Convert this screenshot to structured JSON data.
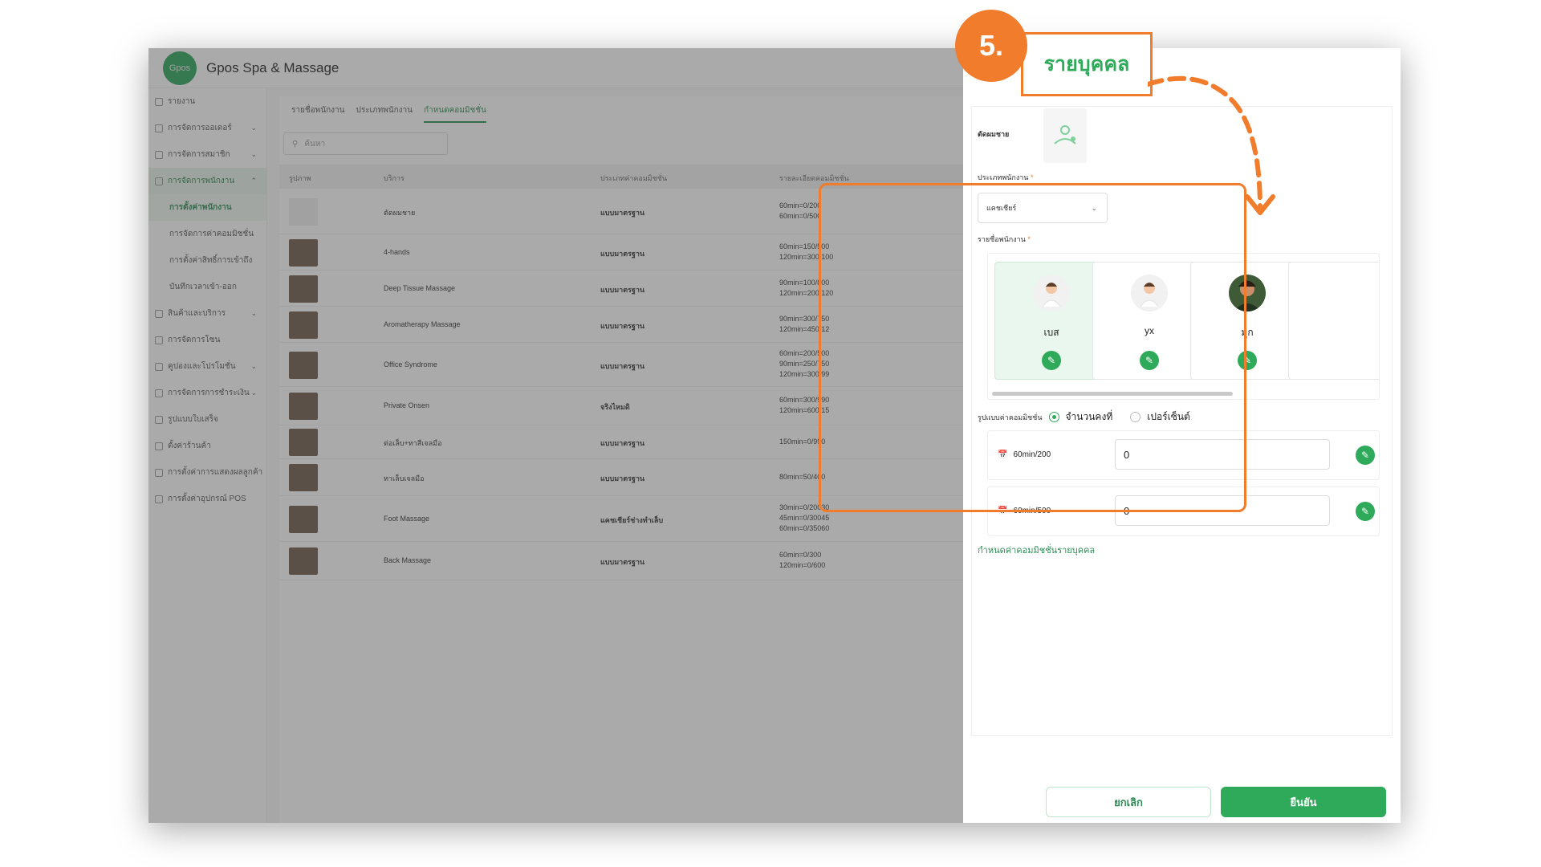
{
  "app": {
    "brand": "Gpos Spa & Massage",
    "logo_text": "Gpos"
  },
  "sidebar": {
    "items": [
      {
        "label": "รายงาน",
        "has_chevron": false
      },
      {
        "label": "การจัดการออเดอร์",
        "has_chevron": true
      },
      {
        "label": "การจัดการสมาชิก",
        "has_chevron": true
      },
      {
        "label": "การจัดการพนักงาน",
        "has_chevron": true,
        "active": true
      }
    ],
    "subitems": [
      {
        "label": "การตั้งค่าพนักงาน",
        "active": true
      },
      {
        "label": "การจัดการค่าคอมมิชชั่น"
      },
      {
        "label": "การตั้งค่าสิทธิ์การเข้าถึง"
      },
      {
        "label": "บันทึกเวลาเข้า-ออก"
      }
    ],
    "items2": [
      {
        "label": "สินค้าและบริการ",
        "has_chevron": true
      },
      {
        "label": "การจัดการโซน",
        "has_chevron": false
      },
      {
        "label": "คูปองและโปรโมชั่น",
        "has_chevron": true
      },
      {
        "label": "การจัดการการชำระเงิน",
        "has_chevron": true
      },
      {
        "label": "รูปแบบใบเสร็จ",
        "has_chevron": false
      },
      {
        "label": "ตั้งค่าร้านค้า",
        "has_chevron": false
      },
      {
        "label": "การตั้งค่าการแสดงผลลูกค้า",
        "has_chevron": false
      },
      {
        "label": "การตั้งค่าอุปกรณ์ POS",
        "has_chevron": false
      }
    ]
  },
  "main": {
    "tabs": [
      "รายชื่อพนักงาน",
      "ประเภทพนักงาน",
      "กำหนดคอมมิชชั่น"
    ],
    "active_tab": 2,
    "search_placeholder": "ค้นหา",
    "columns": [
      "รูปภาพ",
      "บริการ",
      "ประเภทค่าคอมมิชชั่น",
      "รายละเอียดคอมมิชชั่น"
    ],
    "rows": [
      {
        "service": "ตัดผมชาย",
        "type": "แบบมาตรฐาน",
        "details": [
          "60min=0/200",
          "60min=0/500"
        ]
      },
      {
        "service": "4-hands",
        "type": "แบบมาตรฐาน",
        "details": [
          "60min=150/500",
          "120min=300/100"
        ]
      },
      {
        "service": "Deep Tissue Massage",
        "type": "แบบมาตรฐาน",
        "details": [
          "90min=100/800",
          "120min=200/120"
        ]
      },
      {
        "service": "Aromatherapy Massage",
        "type": "แบบมาตรฐาน",
        "details": [
          "90min=300/750",
          "120min=450/12"
        ]
      },
      {
        "service": "Office Syndrome",
        "type": "แบบมาตรฐาน",
        "details": [
          "60min=200/500",
          "90min=250/750",
          "120min=300/99"
        ]
      },
      {
        "service": "Private Onsen",
        "type": "จริงไหมดิ",
        "details": [
          "60min=300/990",
          "120min=600/15"
        ]
      },
      {
        "service": "ต่อเล็บ+ทาสีเจลมือ",
        "type": "แบบมาตรฐาน",
        "details": [
          "150min=0/990"
        ]
      },
      {
        "service": "ทาเล็บเจลมือ",
        "type": "แบบมาตรฐาน",
        "details": [
          "80min=50/400"
        ]
      },
      {
        "service": "Foot Massage",
        "type": "แคชเชียร์ช่างทำเล็บ",
        "details": [
          "30min=0/20030",
          "45min=0/30045",
          "60min=0/35060"
        ]
      },
      {
        "service": "Back Massage",
        "type": "แบบมาตรฐาน",
        "details": [
          "60min=0/300",
          "120min=0/600"
        ]
      }
    ]
  },
  "panel": {
    "service_name": "ตัดผมชาย",
    "staff_type_label": "ประเภทพนักงาน",
    "staff_type_value": "แคชเชียร์",
    "staff_list_label": "รายชื่อพนักงาน",
    "required_mark": "*",
    "staff": [
      {
        "name": "เบส",
        "selected": true
      },
      {
        "name": "yx",
        "selected": false
      },
      {
        "name": "มุก",
        "selected": false
      }
    ],
    "commission_mode_label": "รูปแบบค่าคอมมิชชั่น",
    "mode_options": [
      "จำนวนคงที่",
      "เปอร์เซ็นต์"
    ],
    "mode_selected": 0,
    "commissions": [
      {
        "time": "60min/200",
        "value": "0"
      },
      {
        "time": "60min/500",
        "value": "0"
      }
    ],
    "individual_link": "กำหนดค่าคอมมิชชั่นรายบุคคล",
    "cancel_label": "ยกเลิก",
    "confirm_label": "ยืนยัน"
  },
  "annotation": {
    "step_number": "5.",
    "step_title": "รายบุคคล",
    "color": "#f07c2c"
  }
}
